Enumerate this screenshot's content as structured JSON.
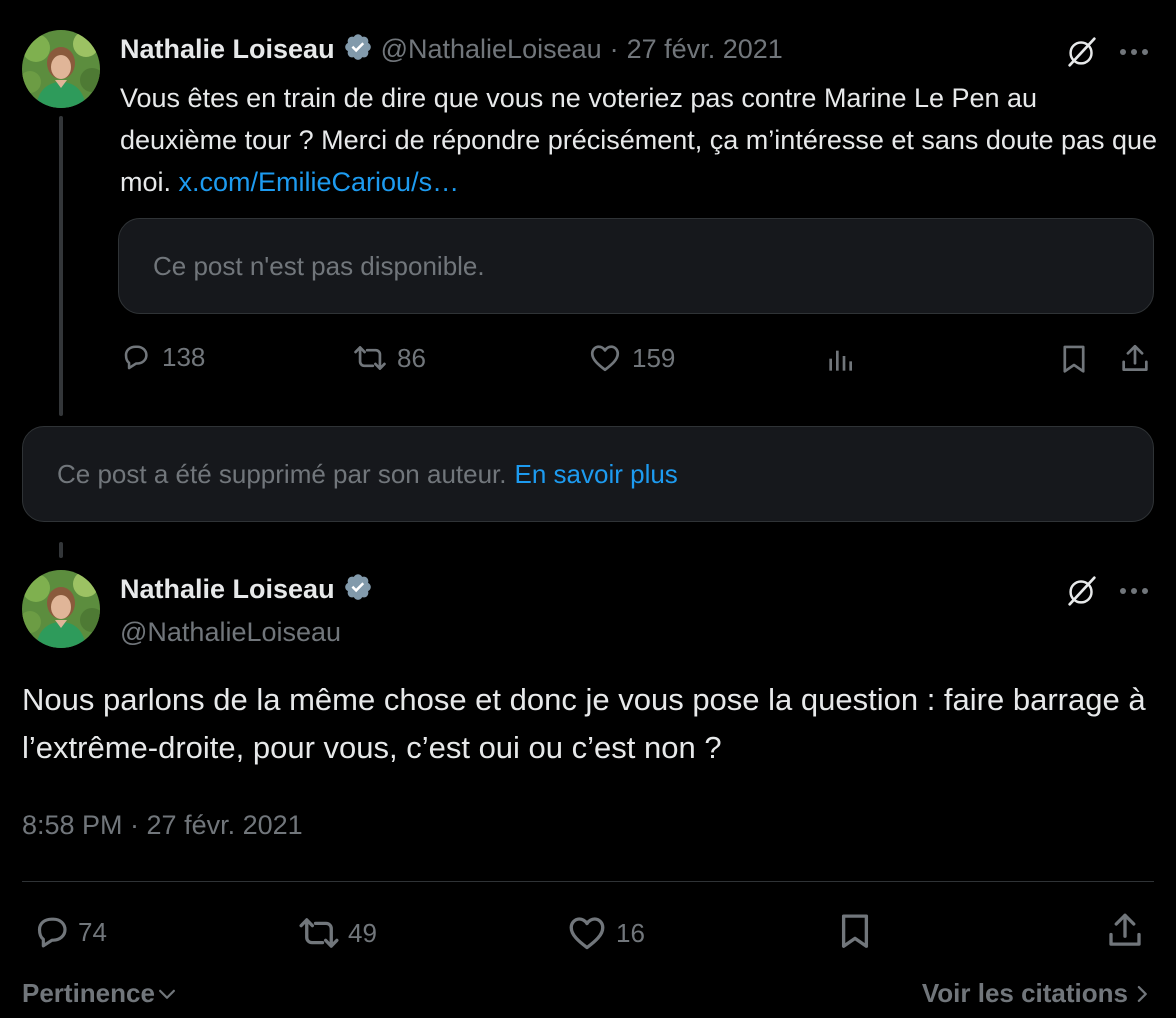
{
  "quoted_tweet": {
    "author_name": "Nathalie Loiseau",
    "handle": "@NathalieLoiseau",
    "separator": "·",
    "date": "27 févr. 2021",
    "text": "Vous êtes en train de dire que vous ne voteriez pas contre Marine Le Pen au deuxième tour ? Merci de répondre précisément, ça m’intéresse et sans doute pas que moi. ",
    "link_text": "x.com/EmilieCariou/s…",
    "unavailable_text": "Ce post n'est pas disponible.",
    "stats": {
      "replies": "138",
      "reposts": "86",
      "likes": "159"
    }
  },
  "deleted_notice": {
    "text": "Ce post a été supprimé par son auteur.",
    "link_text": "En savoir plus"
  },
  "main_tweet": {
    "author_name": "Nathalie Loiseau",
    "handle": "@NathalieLoiseau",
    "text": "Nous parlons de la même chose et donc je vous pose la question : faire barrage à l’extrême-droite, pour vous, c’est oui ou c’est non ?",
    "timestamp": "8:58 PM · 27 févr. 2021",
    "stats": {
      "replies": "74",
      "reposts": "49",
      "likes": "16"
    }
  },
  "footer": {
    "sort_label": "Pertinence",
    "quotes_label": "Voir les citations"
  },
  "colors": {
    "background": "#000000",
    "text": "#e7e9ea",
    "muted": "#71767b",
    "accent": "#1d9bf0",
    "verified": "#829aab",
    "border": "#2f3336"
  },
  "icons": [
    "verified-badge-icon",
    "grok-icon",
    "more-icon",
    "reply-icon",
    "repost-icon",
    "like-icon",
    "views-icon",
    "bookmark-icon",
    "share-icon",
    "chevron-down-icon",
    "chevron-right-icon"
  ]
}
